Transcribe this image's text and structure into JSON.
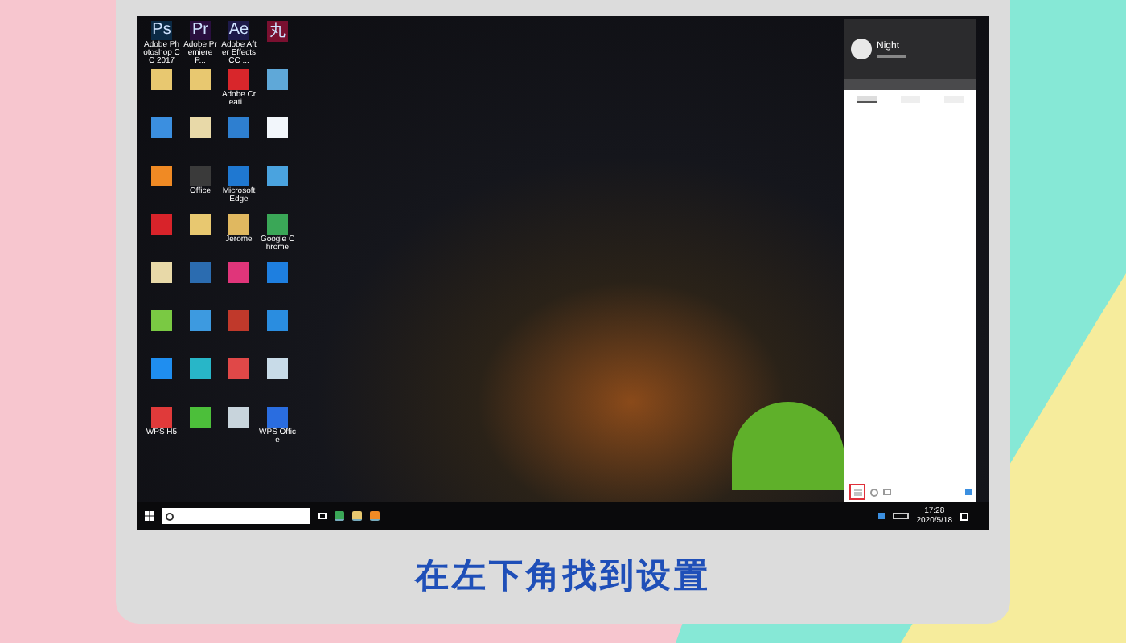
{
  "desktop_icons": [
    {
      "label": "Adobe Photoshop CC 2017",
      "glyph": "Ps",
      "color": "#0b2a45"
    },
    {
      "label": "Adobe Premiere P...",
      "glyph": "Pr",
      "color": "#2a0f3f"
    },
    {
      "label": "Adobe After Effects CC ...",
      "glyph": "Ae",
      "color": "#1d1a4a"
    },
    {
      "glyph": "丸",
      "color": "#7a1030"
    },
    {
      "color": "#e8c870"
    },
    {
      "color": "#e8c870"
    },
    {
      "label": "Adobe Creati...",
      "color": "#d8262b"
    },
    {
      "color": "#5fa8d8"
    },
    {
      "color": "#3b8fe0"
    },
    {
      "color": "#e8d9a8"
    },
    {
      "color": "#2e7fd0"
    },
    {
      "color": "#f2f6fb"
    },
    {
      "color": "#f08a24"
    },
    {
      "label": "Office",
      "color": "#3a3a3a"
    },
    {
      "label": "Microsoft Edge",
      "color": "#1f78d1"
    },
    {
      "color": "#4aa3df"
    },
    {
      "color": "#d8232a"
    },
    {
      "color": "#e8c870"
    },
    {
      "label": "Jerome",
      "color": "#e0b860"
    },
    {
      "label": "Google Chrome",
      "color": "#3aa757"
    },
    {
      "color": "#e8d9a8"
    },
    {
      "color": "#2b6cb0"
    },
    {
      "color": "#e0357a"
    },
    {
      "color": "#1e7fe0"
    },
    {
      "color": "#7ac943"
    },
    {
      "color": "#3d9ae0"
    },
    {
      "color": "#c0392b"
    },
    {
      "color": "#2a8de0"
    },
    {
      "color": "#1f8ef0"
    },
    {
      "color": "#28b6c8"
    },
    {
      "color": "#e04848"
    },
    {
      "color": "#c8dbe8"
    },
    {
      "label": "WPS H5",
      "color": "#e03a3a"
    },
    {
      "color": "#4cbf3a"
    },
    {
      "color": "#c8d4dc"
    },
    {
      "label": "WPS Office",
      "color": "#2a6de0"
    }
  ],
  "qq_panel": {
    "name": "Night",
    "tabs": [
      {
        "selected": true
      },
      {
        "selected": false
      },
      {
        "selected": false
      }
    ]
  },
  "taskbar": {
    "time": "17:28",
    "date": "2020/5/18"
  },
  "caption": "在左下角找到设置"
}
